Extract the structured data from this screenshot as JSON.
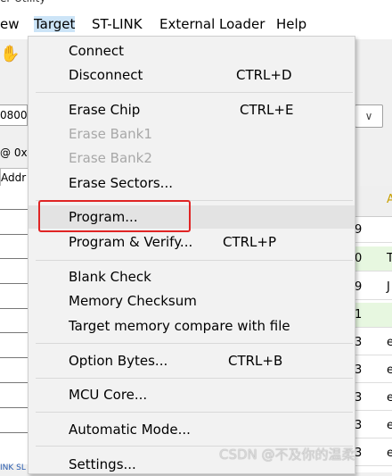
{
  "menubar": {
    "items": [
      "ew",
      "Target",
      "ST-LINK",
      "External Loader",
      "Help"
    ]
  },
  "background": {
    "address_value": "0800",
    "tab_text": "@ 0x",
    "addr_header": "Addr",
    "right_column": [
      {
        "text": "9",
        "extra": "",
        "highlight": false
      },
      {
        "text": "0",
        "extra": "T",
        "highlight": true
      },
      {
        "text": "9",
        "extra": "J",
        "highlight": false
      },
      {
        "text": "1",
        "extra": "",
        "highlight": true
      },
      {
        "text": "3",
        "extra": "e",
        "highlight": false
      },
      {
        "text": "3",
        "extra": "e",
        "highlight": false
      },
      {
        "text": "3",
        "extra": "e",
        "highlight": false
      },
      {
        "text": "3",
        "extra": "e",
        "highlight": false
      },
      {
        "text": "3",
        "extra": "e",
        "highlight": false
      }
    ],
    "right_header": "A",
    "status_fragment": "INK SL"
  },
  "menu": {
    "items": [
      {
        "label": "Connect",
        "shortcut": "",
        "disabled": false
      },
      {
        "label": "Disconnect",
        "shortcut": "CTRL+D",
        "disabled": false
      },
      {
        "label": "Erase Chip",
        "shortcut": "CTRL+E",
        "disabled": false
      },
      {
        "label": "Erase Bank1",
        "shortcut": "",
        "disabled": true
      },
      {
        "label": "Erase Bank2",
        "shortcut": "",
        "disabled": true
      },
      {
        "label": "Erase Sectors...",
        "shortcut": "",
        "disabled": false
      },
      {
        "label": "Program...",
        "shortcut": "",
        "disabled": false
      },
      {
        "label": "Program & Verify...",
        "shortcut": "CTRL+P",
        "disabled": false
      },
      {
        "label": "Blank Check",
        "shortcut": "",
        "disabled": false
      },
      {
        "label": "Memory Checksum",
        "shortcut": "",
        "disabled": false
      },
      {
        "label": "Target memory compare with file",
        "shortcut": "",
        "disabled": false
      },
      {
        "label": "Option Bytes...",
        "shortcut": "CTRL+B",
        "disabled": false
      },
      {
        "label": "MCU Core...",
        "shortcut": "",
        "disabled": false
      },
      {
        "label": "Automatic Mode...",
        "shortcut": "",
        "disabled": false
      },
      {
        "label": "Settings...",
        "shortcut": "",
        "disabled": false
      }
    ],
    "highlighted_item": "Program..."
  },
  "watermark": "CSDN @不及你的温柔",
  "colors": {
    "highlight_box": "#e02424",
    "menu_bg": "#f2f2f2",
    "active_menu": "#cce4f7"
  }
}
